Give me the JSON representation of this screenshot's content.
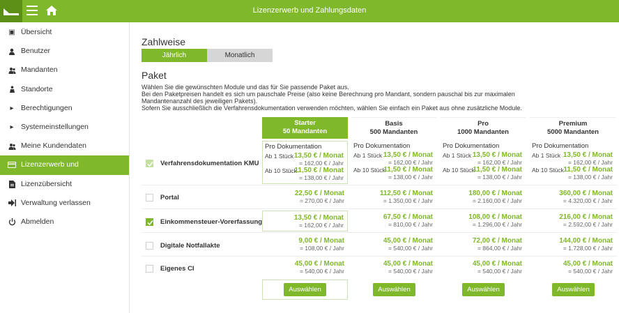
{
  "header": {
    "title": "Lizenzerwerb und Zahlungsdaten"
  },
  "sidebar": {
    "items": [
      {
        "label": "Übersicht",
        "icon": "overview-icon",
        "active": false
      },
      {
        "label": "Benutzer",
        "icon": "user-icon",
        "active": false
      },
      {
        "label": "Mandanten",
        "icon": "clients-icon",
        "active": false
      },
      {
        "label": "Standorte",
        "icon": "location-icon",
        "active": false
      },
      {
        "label": "Berechtigungen",
        "icon": "chevron-right-icon",
        "active": false
      },
      {
        "label": "Systemeinstellungen",
        "icon": "chevron-right-icon",
        "active": false
      },
      {
        "label": "Meine Kundendaten",
        "icon": "customer-icon",
        "active": false
      },
      {
        "label": "Lizenzerwerb und Zahlungsdaten",
        "icon": "credit-card-icon",
        "active": true
      },
      {
        "label": "Lizenzübersicht",
        "icon": "document-icon",
        "active": false
      },
      {
        "label": "Verwaltung verlassen",
        "icon": "exit-icon",
        "active": false
      },
      {
        "label": "Abmelden",
        "icon": "power-icon",
        "active": false
      }
    ]
  },
  "zahlweise": {
    "heading": "Zahlweise",
    "options": [
      "Jährlich",
      "Monatlich"
    ],
    "selected": "Jährlich"
  },
  "paket": {
    "heading": "Paket",
    "intro": [
      "Wählen Sie die gewünschten Module und das für Sie passende Paket aus.",
      "Bei den Paketpreisen handelt es sich um pauschale Preise (also keine Berechnung pro Mandant, sondern pauschal bis zur maximalen",
      "Mandantenanzahl des jeweiligen Pakets).",
      "Sofern Sie ausschließlich die Verfahrensdokumentation verwenden möchten, wählen Sie einfach ein Paket aus ohne zusätzliche Module."
    ],
    "packages": [
      {
        "name": "Starter",
        "clients": "50 Mandanten",
        "highlight": true
      },
      {
        "name": "Basis",
        "clients": "500 Mandanten",
        "highlight": false
      },
      {
        "name": "Pro",
        "clients": "1000 Mandanten",
        "highlight": false
      },
      {
        "name": "Premium",
        "clients": "5000 Mandanten",
        "highlight": false
      }
    ],
    "doc_row": {
      "name": "Verfahrensdokumentation KMU",
      "checked": true,
      "title": "Pro Dokumentation",
      "tier1_label": "Ab 1 Stück",
      "tier10_label": "Ab 10 Stück",
      "tier1_month": "13,50 € / Monat",
      "tier1_year": "= 162,00 € / Jahr",
      "tier10_month": "11,50 € / Monat",
      "tier10_year": "= 138,00 € / Jahr"
    },
    "modules": [
      {
        "name": "Portal",
        "checked": false,
        "prices": [
          {
            "month": "22,50 € / Monat",
            "year": "= 270,00 € / Jahr"
          },
          {
            "month": "112,50 € / Monat",
            "year": "= 1.350,00 € / Jahr"
          },
          {
            "month": "180,00 € / Monat",
            "year": "= 2.160,00 € / Jahr"
          },
          {
            "month": "360,00 € / Monat",
            "year": "= 4.320,00 € / Jahr"
          }
        ]
      },
      {
        "name": "Einkommensteuer-Vorerfassung",
        "checked": true,
        "prices": [
          {
            "month": "13,50 € / Monat",
            "year": "= 162,00 € / Jahr"
          },
          {
            "month": "67,50 € / Monat",
            "year": "= 810,00 € / Jahr"
          },
          {
            "month": "108,00 € / Monat",
            "year": "= 1.296,00 € / Jahr"
          },
          {
            "month": "216,00 € / Monat",
            "year": "= 2.592,00 € / Jahr"
          }
        ]
      },
      {
        "name": "Digitale Notfallakte",
        "checked": false,
        "prices": [
          {
            "month": "9,00 € / Monat",
            "year": "= 108,00 € / Jahr"
          },
          {
            "month": "45,00 € / Monat",
            "year": "= 540,00 € / Jahr"
          },
          {
            "month": "72,00 € / Monat",
            "year": "= 864,00 € / Jahr"
          },
          {
            "month": "144,00 € / Monat",
            "year": "= 1.728,00 € / Jahr"
          }
        ]
      },
      {
        "name": "Eigenes CI",
        "checked": false,
        "prices": [
          {
            "month": "45,00 € / Monat",
            "year": "= 540,00 € / Jahr"
          },
          {
            "month": "45,00 € / Monat",
            "year": "= 540,00 € / Jahr"
          },
          {
            "month": "45,00 € / Monat",
            "year": "= 540,00 € / Jahr"
          },
          {
            "month": "45,00 € / Monat",
            "year": "= 540,00 € / Jahr"
          }
        ]
      }
    ],
    "select_label": "Auswählen"
  },
  "colors": {
    "accent": "#7fb82a",
    "accent_dark": "#5c8f16"
  }
}
